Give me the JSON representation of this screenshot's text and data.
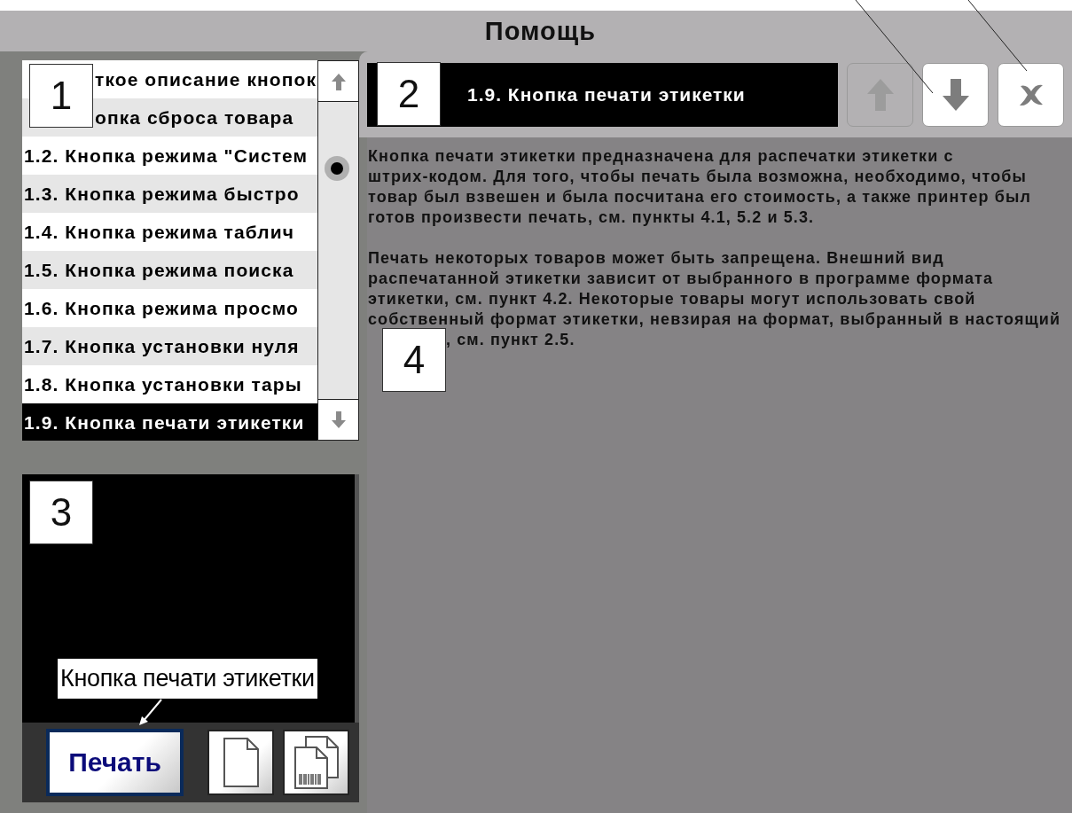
{
  "window": {
    "title": "Помощь"
  },
  "topics": [
    {
      "label": "ткое описание кнопок",
      "selected": false
    },
    {
      "label": "опка сброса товара",
      "selected": false
    },
    {
      "label": "1.2. Кнопка режима \"Систем",
      "selected": false
    },
    {
      "label": "1.3. Кнопка режима быстро",
      "selected": false
    },
    {
      "label": "1.4. Кнопка режима таблич",
      "selected": false
    },
    {
      "label": "1.5. Кнопка режима поиска",
      "selected": false
    },
    {
      "label": "1.6. Кнопка режима просмо",
      "selected": false
    },
    {
      "label": "1.7. Кнопка установки нуля",
      "selected": false
    },
    {
      "label": "1.8. Кнопка установки тары",
      "selected": false
    },
    {
      "label": "1.9. Кнопка печати этикетки",
      "selected": true
    }
  ],
  "topic_title": "1.9. Кнопка печати этикетки",
  "nav_buttons": [
    {
      "kind": "up",
      "disabled": true
    },
    {
      "kind": "down",
      "disabled": false
    },
    {
      "kind": "close",
      "disabled": false
    }
  ],
  "help_text": [
    {
      "lines": [
        "Кнопка печати этикетки предназначена для распечатки этикетки с",
        "штрих-кодом. Для того, чтобы печать была возможна, необходимо, чтобы",
        "товар был взвешен и была посчитана его стоимость, а также принтер был",
        "готов произвести печать, см. пункты 4.1, 5.2 и 5.3."
      ]
    },
    {
      "lines": [
        "Печать некоторых товаров может быть запрещена. Внешний вид",
        "распечатанной этикетки зависит от выбранного в программе формата",
        "этикетки, см. пункт 4.2. Некоторые товары могут использовать свой",
        "собственный формат этикетки, невзирая на формат, выбранный в настоящий"
      ]
    },
    {
      "lines": [
        ", см. пункт 2.5."
      ]
    }
  ],
  "preview_tooltip": "Кнопка печати этикетки",
  "toolbar": [
    {
      "kind": "text",
      "label": "Печать",
      "selected": true
    },
    {
      "kind": "page",
      "selected": false
    },
    {
      "kind": "pages-barcode",
      "selected": false
    }
  ],
  "callouts": [
    "1",
    "2",
    "4",
    "3"
  ]
}
